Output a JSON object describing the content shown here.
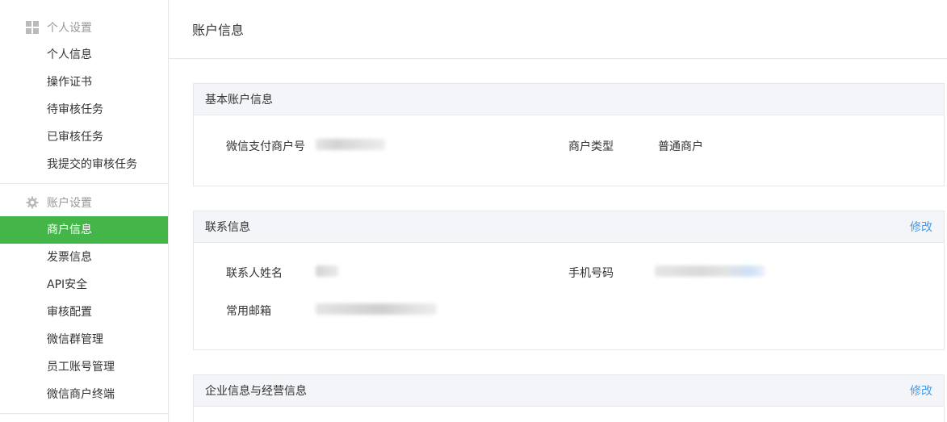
{
  "sidebar": {
    "groups": [
      {
        "label": "个人设置",
        "icon": "grid-icon",
        "items": [
          {
            "label": "个人信息"
          },
          {
            "label": "操作证书"
          },
          {
            "label": "待审核任务"
          },
          {
            "label": "已审核任务"
          },
          {
            "label": "我提交的审核任务"
          }
        ]
      },
      {
        "label": "账户设置",
        "icon": "gear-icon",
        "items": [
          {
            "label": "商户信息",
            "active": true
          },
          {
            "label": "发票信息"
          },
          {
            "label": "API安全"
          },
          {
            "label": "审核配置"
          },
          {
            "label": "微信群管理"
          },
          {
            "label": "员工账号管理"
          },
          {
            "label": "微信商户终端"
          }
        ]
      }
    ]
  },
  "page": {
    "title": "账户信息"
  },
  "panels": {
    "basic": {
      "title": "基本账户信息",
      "merchant_id_label": "微信支付商户号",
      "merchant_type_label": "商户类型",
      "merchant_type_value": "普通商户"
    },
    "contact": {
      "title": "联系信息",
      "action": "修改",
      "name_label": "联系人姓名",
      "phone_label": "手机号码",
      "email_label": "常用邮箱"
    },
    "enterprise": {
      "title": "企业信息与经营信息",
      "action": "修改"
    }
  },
  "colors": {
    "accent": "#44b549",
    "link": "#459ae9",
    "panel_header_bg": "#f4f5f9"
  }
}
